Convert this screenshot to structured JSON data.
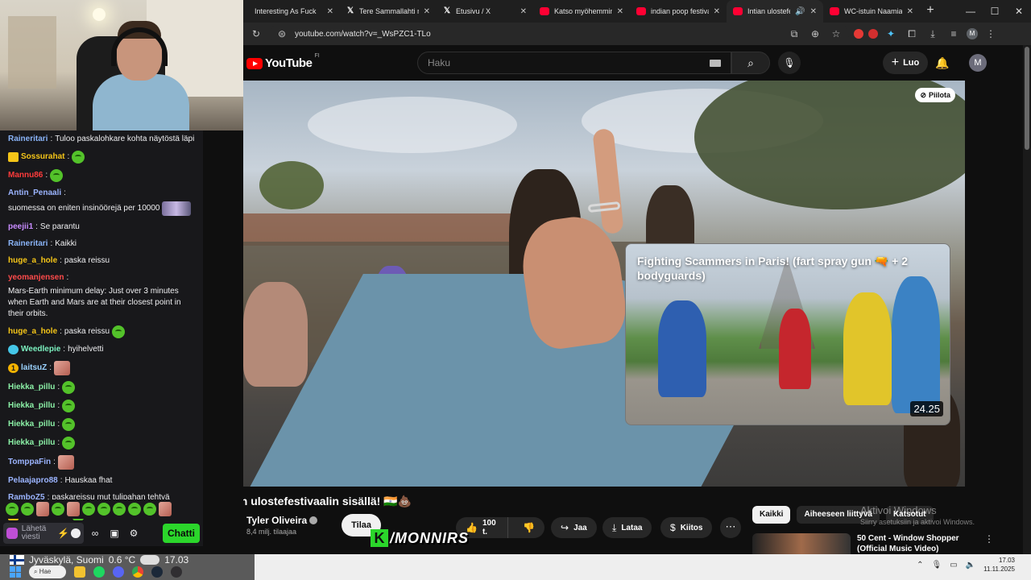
{
  "stream_chat": {
    "messages": [
      {
        "user": "Raineritari",
        "color": "#8ab4f8",
        "text": "Tuloo paskalohkare kohta näytöstä läpi",
        "badge": "",
        "emotes": []
      },
      {
        "user": "Sossurahat",
        "color": "#f5c518",
        "text": "",
        "badge": "crown",
        "emotes": [
          "green"
        ]
      },
      {
        "user": "Mannu86",
        "color": "#ff3b3b",
        "text": "",
        "badge": "",
        "emotes": [
          "green"
        ]
      },
      {
        "user": "Antin_Penaali",
        "color": "#9bb4ff",
        "text": "suomessa on eniten insinöörejä per 10000",
        "badge": "",
        "emotes": [
          "wide"
        ]
      },
      {
        "user": "peejii1",
        "color": "#c78bff",
        "text": "Se parantu",
        "badge": "",
        "emotes": []
      },
      {
        "user": "Raineritari",
        "color": "#8ab4f8",
        "text": "Kaikki",
        "badge": "",
        "emotes": []
      },
      {
        "user": "huge_a_hole",
        "color": "#f5c518",
        "text": "paska reissu",
        "badge": "",
        "emotes": []
      },
      {
        "user": "yeomanjensen",
        "color": "#ff4b4b",
        "text": "Mars-Earth minimum delay: Just over 3 minutes when Earth and Mars are at their closest point in their orbits.",
        "badge": "",
        "emotes": []
      },
      {
        "user": "huge_a_hole",
        "color": "#f5c518",
        "text": "paska reissu",
        "badge": "",
        "emotes": [
          "green"
        ]
      },
      {
        "user": "Weedlepie",
        "color": "#7cf2c0",
        "text": "hyihelvetti",
        "badge": "drop",
        "emotes": []
      },
      {
        "user": "laitsuZ",
        "color": "#9bd3ff",
        "text": "",
        "badge": "1",
        "emotes": [
          "pic"
        ]
      },
      {
        "user": "Hiekka_pillu",
        "color": "#8bf0a6",
        "text": "",
        "badge": "",
        "emotes": [
          "green"
        ]
      },
      {
        "user": "Hiekka_pillu",
        "color": "#8bf0a6",
        "text": "",
        "badge": "",
        "emotes": [
          "green"
        ]
      },
      {
        "user": "Hiekka_pillu",
        "color": "#8bf0a6",
        "text": "",
        "badge": "",
        "emotes": [
          "green"
        ]
      },
      {
        "user": "Hiekka_pillu",
        "color": "#8bf0a6",
        "text": "",
        "badge": "",
        "emotes": [
          "green"
        ]
      },
      {
        "user": "TomppaFin",
        "color": "#9bb4ff",
        "text": "",
        "badge": "",
        "emotes": [
          "pic"
        ]
      },
      {
        "user": "Pelaajapro88",
        "color": "#9bb4ff",
        "text": "Hauskaa fhat",
        "badge": "",
        "emotes": []
      },
      {
        "user": "RamboZ5",
        "color": "#9bb4ff",
        "text": "paskareissu mut tulipahan tehtyä",
        "badge": "",
        "emotes": []
      },
      {
        "user": "Sossurahat",
        "color": "#f5c518",
        "text": "",
        "badge": "crown",
        "emotes": [
          "green"
        ]
      }
    ],
    "input_placeholder": "Lähetä viesti",
    "send_label": "Chatti"
  },
  "browser": {
    "tabs": [
      {
        "title": "Interesting As Fuck",
        "icon": "blank",
        "active": false
      },
      {
        "title": "Tere Sammallahti n",
        "icon": "x",
        "active": false
      },
      {
        "title": "Etusivu / X",
        "icon": "x",
        "active": false
      },
      {
        "title": "Katso myöhemmin",
        "icon": "yt",
        "active": false
      },
      {
        "title": "indian poop festival",
        "icon": "yt",
        "active": false
      },
      {
        "title": "Intian ulostefesti",
        "icon": "yt",
        "active": true
      },
      {
        "title": "WC-istuin Naamiaisa",
        "icon": "yt",
        "active": false
      }
    ],
    "url": "youtube.com/watch?v=_WsPZC1-TLo",
    "profile_initial": "M"
  },
  "youtube": {
    "logo": "YouTube",
    "region": "FI",
    "search_placeholder": "Haku",
    "create_label": "Luo",
    "avatar_initial": "M",
    "hide_label": "Piilota",
    "endcard": {
      "title": "Fighting Scammers in Paris! (fart spray gun 🔫 + 2 bodyguards)",
      "duration": "24.25"
    },
    "video_title": "Intian ulostefestivaalin sisällä! 🇮🇳💩",
    "channel": {
      "name": "Tyler Oliveira",
      "subscribers": "8,4 milj. tilaajaa"
    },
    "subscribe_label": "Tilaa",
    "likes": "100 t.",
    "share_label": "Jaa",
    "download_label": "Lataa",
    "thanks_label": "Kiitos",
    "chips": [
      "Kaikki",
      "Aiheeseen liittyvä",
      "Katsotut"
    ],
    "recommendation": {
      "title": "50 Cent - Window Shopper (Official Music Video)"
    }
  },
  "windows_watermark": {
    "line1": "Aktivoi Windows",
    "line2": "Siirry asetuksiin ja aktivoi Windows."
  },
  "overlay_brand": {
    "letter": "K",
    "text": "/MONNIRS"
  },
  "taskbar": {
    "weather_location": "Jyväskylä, Suomi",
    "temperature": "0.6 °C",
    "overlay_time": "17.03",
    "search_label": "Hae",
    "clock_time": "17.03",
    "clock_date": "11.11.2025"
  }
}
